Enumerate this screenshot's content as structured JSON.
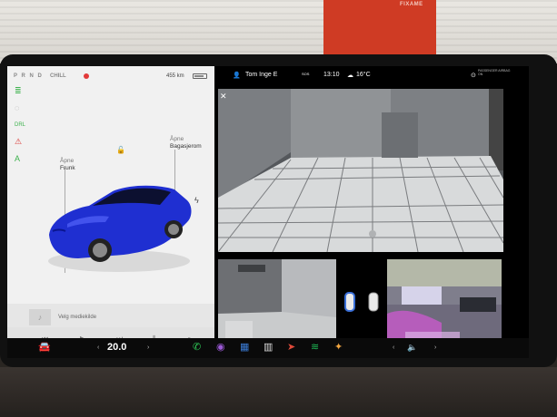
{
  "backdrop": {
    "sign_text": "FIXAME"
  },
  "car_panel": {
    "gear": "P R N D",
    "drive_mode": "CHILL",
    "range": "455 km",
    "battery_level": 0.8,
    "indicators": [
      {
        "name": "headlights-icon",
        "glyph": "≣",
        "color": "#3fb34f"
      },
      {
        "name": "tpms-icon",
        "glyph": "◌",
        "color": "#999999"
      },
      {
        "name": "drl-icon",
        "glyph": "DRL",
        "color": "#3fb34f"
      },
      {
        "name": "seatbelt-icon",
        "glyph": "⚠",
        "color": "#d9322e"
      },
      {
        "name": "auto-lights-icon",
        "glyph": "A",
        "color": "#3fb34f"
      }
    ],
    "frunk": {
      "action": "Åpne",
      "name": "Frunk"
    },
    "trunk": {
      "action": "Åpne",
      "name": "Bagasjerom"
    },
    "car_color": "#1f2fd1"
  },
  "media": {
    "placeholder": "Velg mediekilde",
    "controls": [
      "⏮",
      "▶",
      "⏭",
      "⦀",
      "⌕"
    ]
  },
  "status_bar": {
    "profile_name": "Tom Inge E",
    "time": "13:10",
    "weather_icon": "☁",
    "temperature": "16°C",
    "airbag_label": "PASSENGER AIRBAG ON"
  },
  "dock": {
    "cabin_temp": "20.0",
    "temp_unit": "",
    "apps": [
      {
        "name": "phone-icon",
        "glyph": "✆",
        "color": "#2fcc57"
      },
      {
        "name": "camera-app-icon",
        "glyph": "◉",
        "color": "#9b59d6"
      },
      {
        "name": "apps-launcher-icon",
        "glyph": "▦",
        "color": "#3a7bd5"
      },
      {
        "name": "toybox-icon",
        "glyph": "▥",
        "color": "#dddddd"
      },
      {
        "name": "navigation-icon",
        "glyph": "➤",
        "color": "#e04a3a"
      },
      {
        "name": "spotify-icon",
        "glyph": "≋",
        "color": "#1db954"
      },
      {
        "name": "games-icon",
        "glyph": "✦",
        "color": "#f2a640"
      }
    ],
    "volume_icon": "🔈"
  },
  "colors": {
    "accent_green": "#3fb34f",
    "record_red": "#e23a3a"
  }
}
